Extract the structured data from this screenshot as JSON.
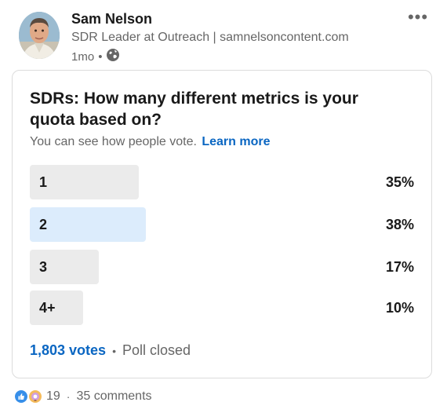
{
  "post": {
    "author_name": "Sam Nelson",
    "author_title": "SDR Leader at Outreach | samnelsoncontent.com",
    "age": "1mo",
    "meta_separator": "•",
    "more_label": "•••"
  },
  "poll": {
    "question": "SDRs: How many different metrics is your quota based on?",
    "visibility_text": "You can see how people vote.",
    "learn_more": "Learn more",
    "options": [
      {
        "label": "1",
        "percent": "35%",
        "selected": false
      },
      {
        "label": "2",
        "percent": "38%",
        "selected": true
      },
      {
        "label": "3",
        "percent": "17%",
        "selected": false
      },
      {
        "label": "4+",
        "percent": "10%",
        "selected": false
      }
    ],
    "votes": "1,803 votes",
    "separator": "•",
    "status": "Poll closed"
  },
  "social": {
    "reaction_icons": [
      "like-icon",
      "insightful-icon"
    ],
    "reactions_count": "19",
    "separator": "·",
    "comments": "35 comments"
  },
  "colors": {
    "accent": "#0a66c2",
    "bar_default": "#ebebeb",
    "bar_selected": "#dcecfc",
    "secondary_text": "#666666"
  }
}
